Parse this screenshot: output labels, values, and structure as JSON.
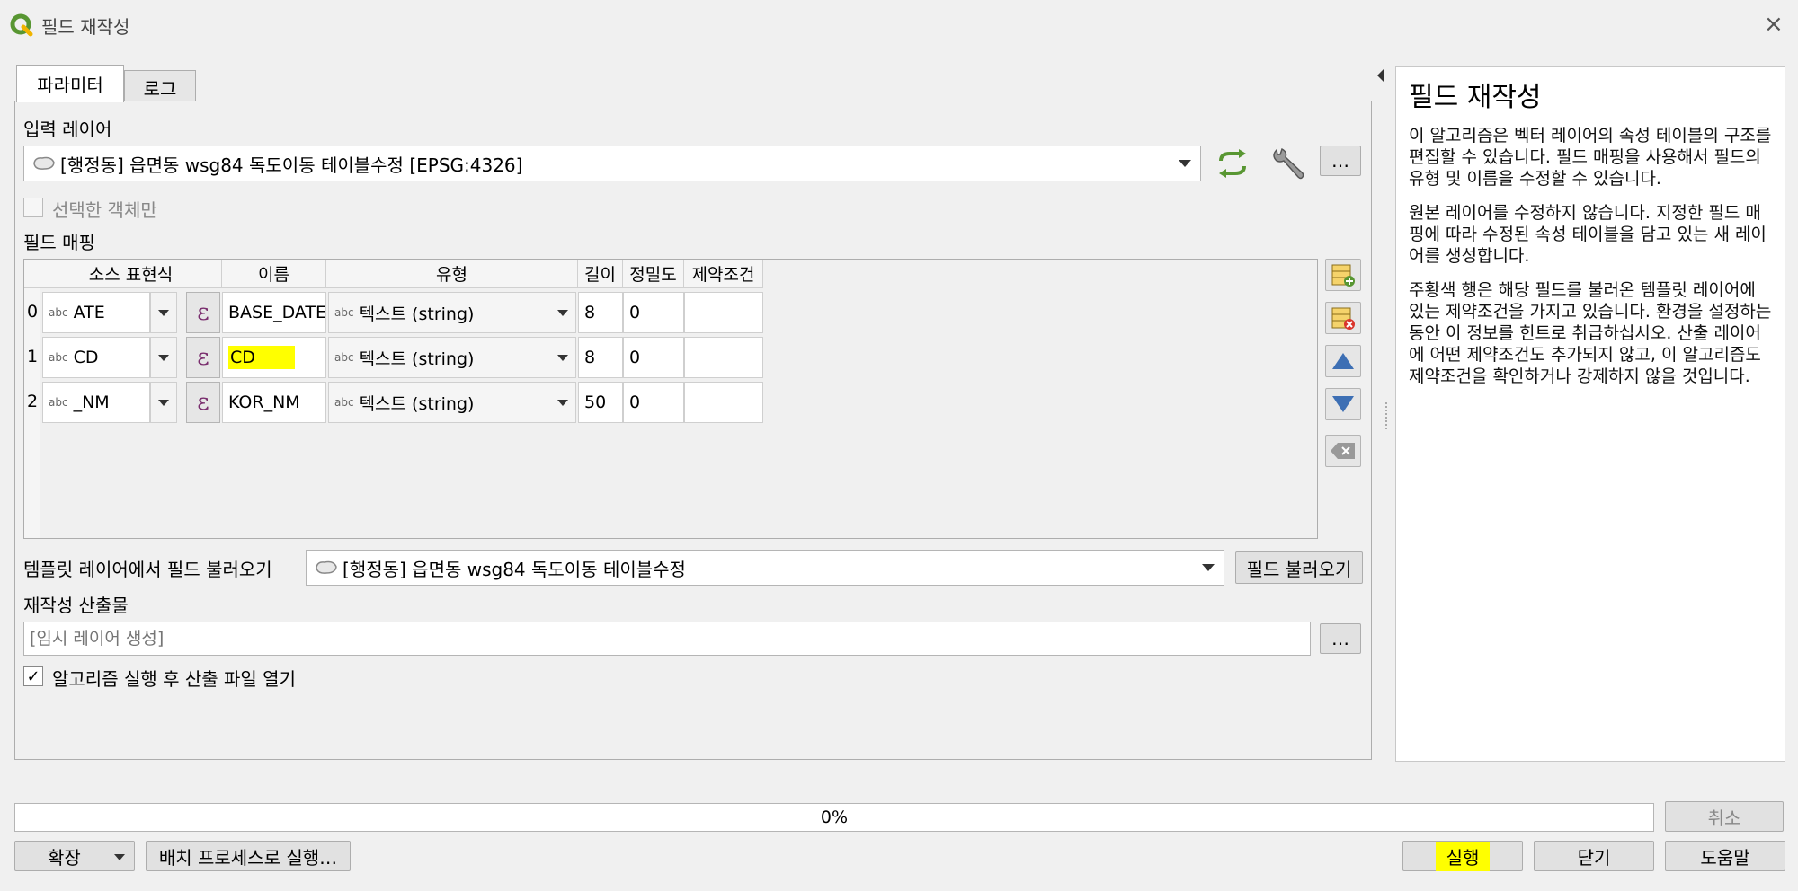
{
  "window": {
    "title": "필드 재작성",
    "close_icon": "×"
  },
  "tabs": [
    {
      "label": "파라미터"
    },
    {
      "label": "로그"
    }
  ],
  "input_layer": {
    "label": "입력 레이어",
    "value": "[행정동] 읍면동 wsg84 독도이동 테이블수정 [EPSG:4326]",
    "selected_only_label": "선택한 객체만"
  },
  "field_mapping": {
    "label": "필드 매핑",
    "columns": [
      "소스 표현식",
      "이름",
      "유형",
      "길이",
      "정밀도",
      "제약조건"
    ],
    "rows": [
      {
        "index": "0",
        "source": "ATE",
        "name": "BASE_DATE",
        "type": "텍스트 (string)",
        "length": "8",
        "precision": "0",
        "constraint": ""
      },
      {
        "index": "1",
        "source": "CD",
        "name": "CD",
        "type": "텍스트 (string)",
        "length": "8",
        "precision": "0",
        "constraint": ""
      },
      {
        "index": "2",
        "source": "_NM",
        "name": "KOR_NM",
        "type": "텍스트 (string)",
        "length": "50",
        "precision": "0",
        "constraint": ""
      }
    ],
    "abc_tag": "abc",
    "epsilon": "ε"
  },
  "template": {
    "label": "템플릿 레이어에서 필드 불러오기",
    "value": "[행정동] 읍면동 wsg84 독도이동 테이블수정",
    "load_button": "필드 불러오기"
  },
  "output": {
    "label": "재작성 산출물",
    "placeholder": "[임시 레이어 생성]",
    "open_after_label": "알고리즘 실행 후 산출 파일 열기",
    "ellipsis": "…"
  },
  "help": {
    "title": "필드 재작성",
    "paragraphs": [
      "이 알고리즘은 벡터 레이어의 속성 테이블의 구조를 편집할 수 있습니다. 필드 매핑을 사용해서 필드의 유형 및 이름을 수정할 수 있습니다.",
      "원본 레이어를 수정하지 않습니다. 지정한 필드 매핑에 따라 수정된 속성 테이블을 담고 있는 새 레이어를 생성합니다.",
      "주황색 행은 해당 필드를 불러온 템플릿 레이어에 있는 제약조건을 가지고 있습니다. 환경을 설정하는 동안 이 정보를 힌트로 취급하십시오. 산출 레이어에 어떤 제약조건도 추가되지 않고, 이 알고리즘도 제약조건을 확인하거나 강제하지 않을 것입니다."
    ]
  },
  "progress": {
    "text": "0%",
    "value": 0
  },
  "buttons": {
    "cancel": "취소",
    "advanced": "확장",
    "batch": "배치 프로세스로 실행…",
    "run": "실행",
    "close": "닫기",
    "help": "도움말"
  },
  "colors": {
    "highlight": "#ffff00",
    "qgis_green": "#589632",
    "epsilon": "#7a2e6e"
  }
}
